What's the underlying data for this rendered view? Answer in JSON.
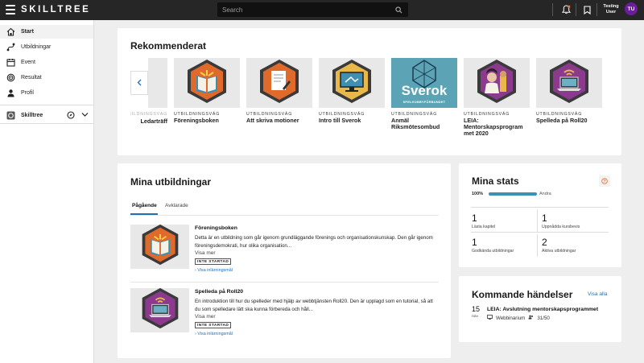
{
  "app": {
    "brand": "SKILLTREE"
  },
  "topbar": {
    "search_placeholder": "Search",
    "user_name": "Testing User",
    "avatar_initials": "TU"
  },
  "sidebar": {
    "items": [
      {
        "label": "Start",
        "icon": "home-icon"
      },
      {
        "label": "Utbildningar",
        "icon": "route-icon"
      },
      {
        "label": "Event",
        "icon": "calendar-icon"
      },
      {
        "label": "Resultat",
        "icon": "target-icon"
      },
      {
        "label": "Profil",
        "icon": "user-icon"
      }
    ],
    "org": {
      "label": "Skilltree",
      "icon": "skilltree-icon"
    }
  },
  "recommended": {
    "title": "Rekommenderat",
    "partial_item": {
      "type": "UTBILDNINGSVÄG",
      "name": "Ledarträff"
    },
    "items": [
      {
        "type": "UTBILDNINGSVÄG",
        "name": "Föreningsboken",
        "icon": "open-book-icon"
      },
      {
        "type": "UTBILDNINGSVÄG",
        "name": "Att skriva motioner",
        "icon": "document-pen-icon"
      },
      {
        "type": "UTBILDNINGSVÄG",
        "name": "Intro till Sverok",
        "icon": "computer-screen-icon"
      },
      {
        "type": "UTBILDNINGSVÄG",
        "name": "Anmäl Riksmötesombud",
        "icon": "sverok-logo-icon",
        "logo_text": "Sverok",
        "logo_subtext": "SPELHOBBYFÖRBUNDET"
      },
      {
        "type": "UTBILDNINGSVÄG",
        "name": "LEIA: Mentorskapsprogram met 2020",
        "icon": "mentor-portrait-icon"
      },
      {
        "type": "UTBILDNINGSVÄG",
        "name": "Spelleda på Roll20",
        "icon": "laptop-wifi-icon"
      }
    ]
  },
  "my_courses": {
    "title": "Mina utbildningar",
    "tabs": [
      "Pågående",
      "Avklarade"
    ],
    "items": [
      {
        "title": "Föreningsboken",
        "desc": "Detta är en utbildning som går igenom grundläggande förenings och organisationskunskap. Den går igenom föreningsdemokrati, hur olika organisation...",
        "more": "Visa mer",
        "status": "INTE STARTAD",
        "goals": "Visa inlärningsmål"
      },
      {
        "title": "Spelleda på Roll20",
        "desc": "En introduktion till hur du spelleder med hjälp av webbtjänsten Roll20. Den är upplagd som en tutorial, så att du som spelledare lätt ska kunna förbereda och håll...",
        "more": "Visa mer",
        "status": "INTE STARTAD",
        "goals": "Visa inlärningsmål"
      }
    ]
  },
  "stats": {
    "title": "Mina stats",
    "progress_percent": "100%",
    "progress_value": 1.0,
    "progress_label": "Andra",
    "cells": [
      {
        "num": "1",
        "label": "Lästa kapitel"
      },
      {
        "num": "1",
        "label": "Uppnådda kursbevis"
      },
      {
        "num": "1",
        "label": "Godkända utbildningar"
      },
      {
        "num": "2",
        "label": "Aktiva utbildningar"
      }
    ],
    "colors": {
      "bar": "#3a93b3",
      "help": "#e8742c"
    }
  },
  "events": {
    "title": "Kommande händelser",
    "see_all": "Visa alla",
    "items": [
      {
        "day": "15",
        "month": "nov.",
        "title": "LEIA: Avslutning mentorskapsprogrammet",
        "type": "Webbinarium",
        "attendees": "31/50"
      }
    ]
  }
}
